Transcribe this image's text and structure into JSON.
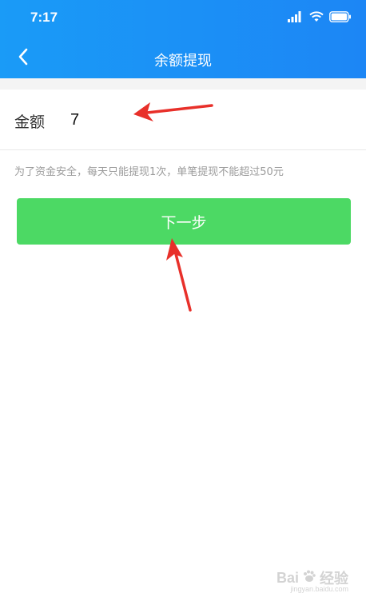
{
  "status_bar": {
    "time": "7:17",
    "icons": [
      "signal-icon",
      "wifi-icon",
      "battery-icon"
    ]
  },
  "nav": {
    "back_icon": "chevron-left-icon",
    "title": "余额提现"
  },
  "form": {
    "amount_label": "金额",
    "amount_value": "7"
  },
  "hint": "为了资金安全，每天只能提现1次，单笔提现不能超过50元",
  "next_button_label": "下一步",
  "watermark": {
    "brand": "Bai",
    "brand2": "经验",
    "url": "jingyan.baidu.com"
  },
  "colors": {
    "header": "#1a9bf7",
    "button": "#4cd964",
    "annotation": "#e8302a"
  }
}
